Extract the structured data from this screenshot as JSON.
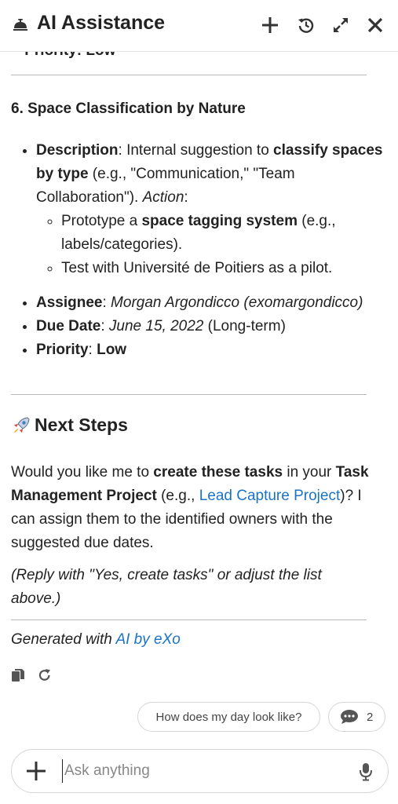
{
  "header": {
    "title": "AI Assistance",
    "icons": [
      "bell-icon",
      "plus-icon",
      "history-icon",
      "expand-icon",
      "close-icon"
    ]
  },
  "cut_item": {
    "label": "Priority",
    "value": "Low"
  },
  "section6": {
    "title": "6. Space Classification by Nature",
    "description_label": "Description",
    "description_pre": ": Internal suggestion to ",
    "description_bold": "classify spaces by type",
    "description_post": " (e.g., \"Communication,\" \"Team Collaboration\"). ",
    "action_label": "Action",
    "action_colon": ":",
    "sub1_pre": "Prototype a ",
    "sub1_bold": "space tagging system",
    "sub1_post": " (e.g., labels/categories).",
    "sub2": "Test with Université de Poitiers as a pilot.",
    "assignee_label": "Assignee",
    "assignee_value": "Morgan Argondicco (exomargondicco)",
    "due_label": "Due Date",
    "due_value": "June 15, 2022",
    "due_note": " (Long-term)",
    "priority_label": "Priority",
    "priority_value": "Low"
  },
  "next_steps": {
    "emoji": "rocket-icon",
    "title": "Next Steps",
    "p1_pre": "Would you like me to ",
    "p1_bold1": "create these tasks",
    "p1_mid": " in your ",
    "p1_bold2": "Task Management Project",
    "p1_mid2": " (e.g., ",
    "p1_link": "Lead Capture Project",
    "p1_post": ")? I can assign them to the identified owners with the suggested due dates.",
    "p2": "(Reply with \"Yes, create tasks\" or adjust the list above.)"
  },
  "footer": {
    "generated_pre": "Generated with ",
    "generated_link": "AI by eXo"
  },
  "suggestions": {
    "chip1": "How does my day look like?",
    "chip2_count": "2"
  },
  "input": {
    "placeholder": "Ask anything",
    "value": ""
  },
  "colors": {
    "link": "#1a73c8",
    "divider": "#b8b8b8",
    "text": "#222222"
  }
}
